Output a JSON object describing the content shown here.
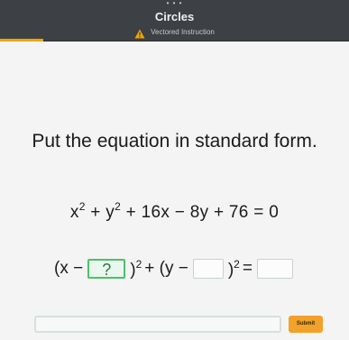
{
  "header": {
    "dots": "• • •",
    "title": "Circles",
    "subtitle": "Vectored Instruction",
    "warning_icon": "warning-triangle-icon",
    "accent_color": "#f0a500"
  },
  "question": {
    "prompt": "Put the equation in standard form.",
    "equation": {
      "x_term": "x",
      "x_exp": "2",
      "plus1": " + ",
      "y_term": "y",
      "y_exp": "2",
      "rest": " + 16x − 8y + 76 = 0"
    }
  },
  "answer": {
    "open_x": "(x − ",
    "blank1_value": "?",
    "close_x": ")",
    "exp1": "2",
    "middle": " + (y − ",
    "close_y": ")",
    "exp2": "2",
    "equals": " = ",
    "active_color": "#4cc06c"
  },
  "footer": {
    "submit_label": "Submit",
    "submit_color": "#f2a12a"
  }
}
